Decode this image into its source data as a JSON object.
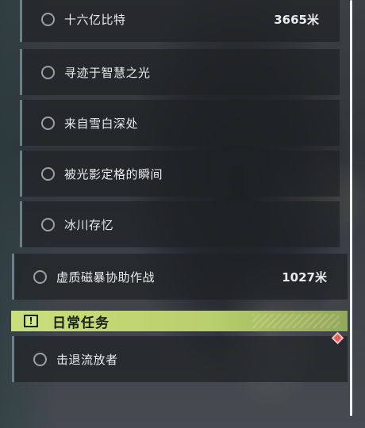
{
  "quests": {
    "sub_items": [
      {
        "title": "十六亿比特",
        "distance": "3665米"
      },
      {
        "title": "寻迹于智慧之光",
        "distance": ""
      },
      {
        "title": "来自雪白深处",
        "distance": ""
      },
      {
        "title": "被光影定格的瞬间",
        "distance": ""
      },
      {
        "title": "冰川存忆",
        "distance": ""
      }
    ],
    "main_item": {
      "title": "虚质磁暴协助作战",
      "distance": "1027米"
    }
  },
  "daily": {
    "header_icon": "!",
    "header_title": "日常任务",
    "items": [
      {
        "title": "击退流放者",
        "distance": ""
      }
    ],
    "marker_icon": "diamond-marker-icon",
    "marker_color": "#e85a5a"
  },
  "colors": {
    "accent": "#c9e07a",
    "card_border": "#6c7f86"
  }
}
